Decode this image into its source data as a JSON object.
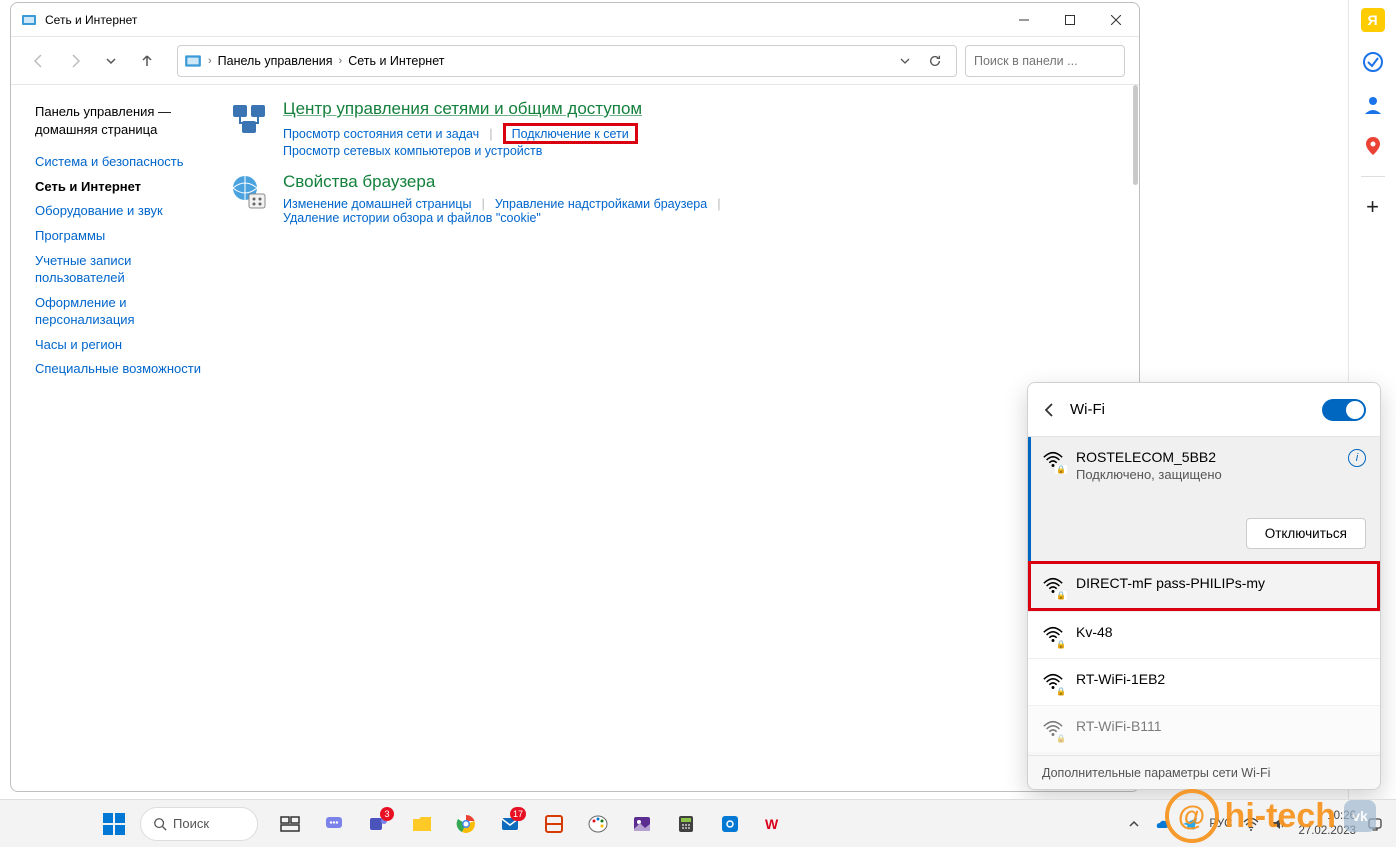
{
  "window": {
    "title": "Сеть и Интернет",
    "breadcrumbs": [
      "Панель управления",
      "Сеть и Интернет"
    ],
    "search_placeholder": "Поиск в панели ..."
  },
  "sidebar": {
    "home": "Панель управления — домашняя страница",
    "items": [
      {
        "label": "Система и безопасность",
        "active": false
      },
      {
        "label": "Сеть и Интернет",
        "active": true
      },
      {
        "label": "Оборудование и звук",
        "active": false
      },
      {
        "label": "Программы",
        "active": false
      },
      {
        "label": "Учетные записи пользователей",
        "active": false
      },
      {
        "label": "Оформление и персонализация",
        "active": false
      },
      {
        "label": "Часы и регион",
        "active": false
      },
      {
        "label": "Специальные возможности",
        "active": false
      }
    ]
  },
  "sections": [
    {
      "title": "Центр управления сетями и общим доступом",
      "tasks": [
        {
          "label": "Просмотр состояния сети и задач"
        },
        {
          "label": "Подключение к сети",
          "highlighted": true
        }
      ],
      "tasks2": [
        {
          "label": "Просмотр сетевых компьютеров и устройств"
        }
      ]
    },
    {
      "title": "Свойства браузера",
      "tasks": [
        {
          "label": "Изменение домашней страницы"
        },
        {
          "label": "Управление надстройками браузера"
        }
      ],
      "tasks2": [
        {
          "label": "Удаление истории обзора и файлов \"cookie\""
        }
      ]
    }
  ],
  "wifi": {
    "title": "Wi-Fi",
    "disconnect": "Отключиться",
    "footer": "Дополнительные параметры сети Wi-Fi",
    "networks": [
      {
        "name": "ROSTELECOM_5BB2",
        "status": "Подключено, защищено",
        "connected": true,
        "secure": true
      },
      {
        "name": "DIRECT-mF pass-PHILIPs-my",
        "secure": true,
        "highlighted": true
      },
      {
        "name": "Kv-48",
        "secure": true
      },
      {
        "name": "RT-WiFi-1EB2",
        "secure": true
      },
      {
        "name": "RT-WiFi-B111",
        "secure": true
      }
    ]
  },
  "taskbar": {
    "search": "Поиск",
    "lang": "РУС",
    "time": "10:26",
    "date": "27.02.2023",
    "badges": {
      "teams": "3",
      "mail": "17"
    }
  },
  "watermark": {
    "brand": "hi-tech",
    "vk": "vk"
  }
}
